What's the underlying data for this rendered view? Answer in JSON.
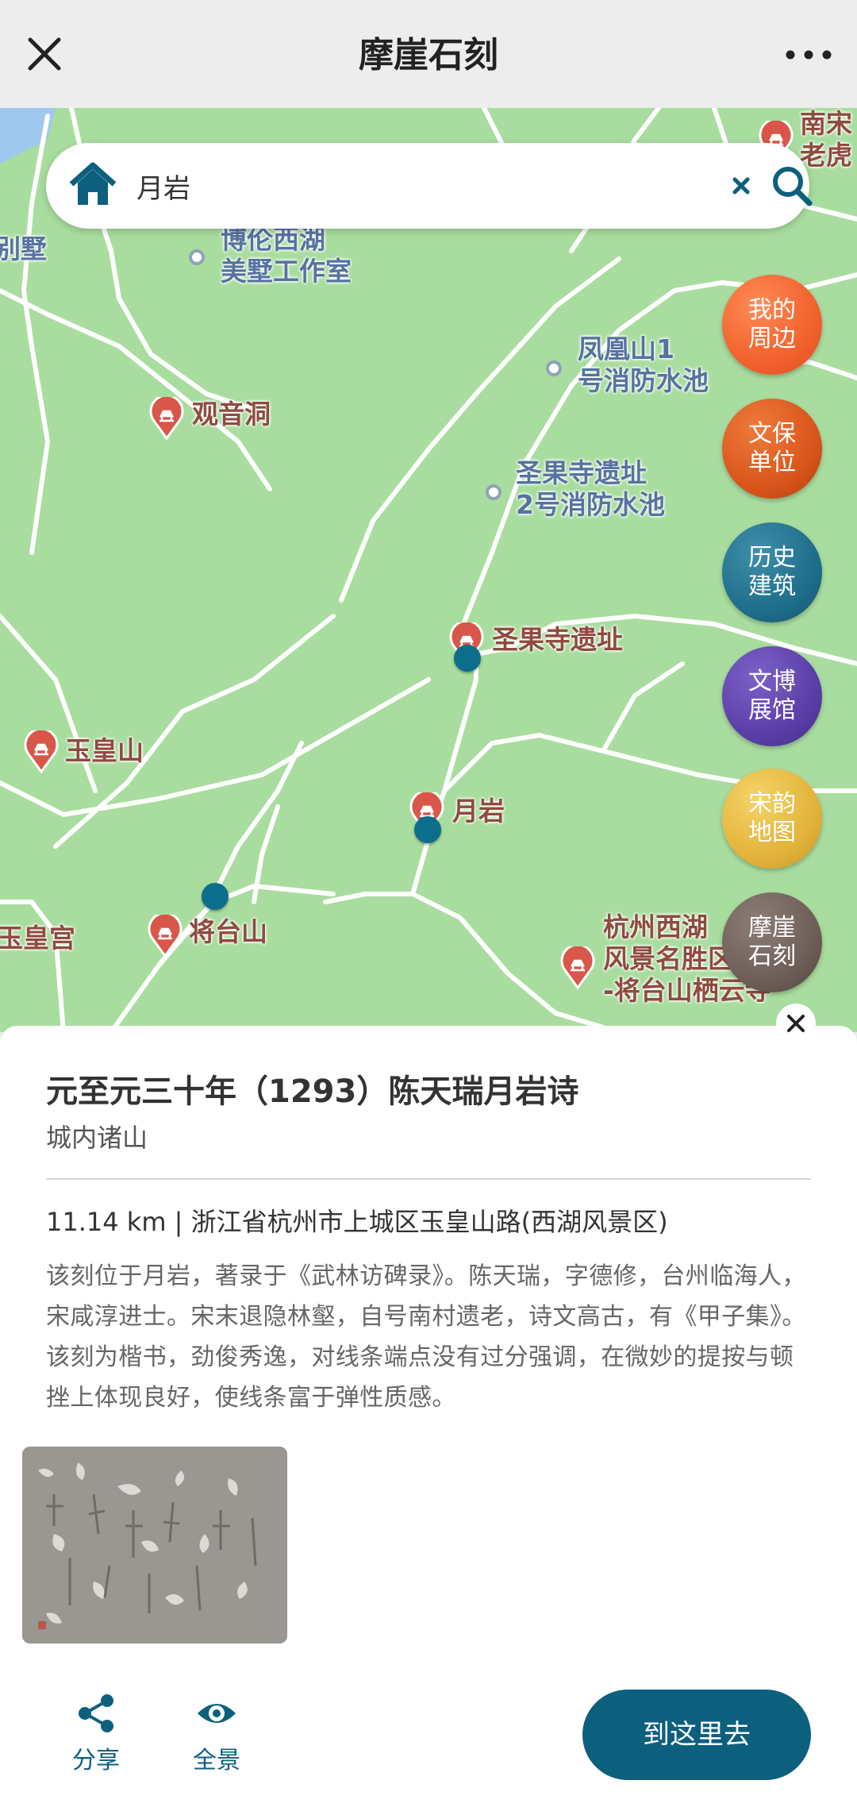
{
  "header": {
    "title": "摩崖石刻"
  },
  "search": {
    "value": "月岩"
  },
  "map": {
    "place_labels": {
      "boluo": "博伦西湖\n美墅工作室",
      "bieshu": "苑别墅",
      "guanyin": "观音洞",
      "fenghuang": "凤凰山1\n号消防水池",
      "shengguo_pool": "圣果寺遗址\n2号消防水池",
      "shengguo": "圣果寺遗址",
      "yuhuangshan": "玉皇山",
      "yueyan": "月岩",
      "jiangtai": "将台山",
      "yuhuanggong": "玉皇宫",
      "xihu": "杭州西湖\n风景名胜区\n-将台山栖云寺",
      "nansong": "南宋\n老虎"
    }
  },
  "categories": [
    {
      "label": "我的周边",
      "color": "#f2622e"
    },
    {
      "label": "文保单位",
      "color": "#d9561c"
    },
    {
      "label": "历史建筑",
      "color": "#1f6f8c"
    },
    {
      "label": "文博展馆",
      "color": "#5b3fa8"
    },
    {
      "label": "宋韵地图",
      "color": "#e3b43a"
    },
    {
      "label": "摩崖石刻",
      "color": "#6f5f58"
    }
  ],
  "detail": {
    "title": "元至元三十年（1293）陈天瑞月岩诗",
    "subtitle": "城内诸山",
    "address": "11.14 km | 浙江省杭州市上城区玉皇山路(西湖风景区)",
    "description": "该刻位于月岩，著录于《武林访碑录》。陈天瑞，字德修，台州临海人，宋咸淳进士。宋末退隐林壑，自号南村遗老，诗文高古，有《甲子集》。该刻为楷书，劲俊秀逸，对线条端点没有过分强调，在微妙的提按与顿挫上体现良好，使线条富于弹性质感。",
    "share_label": "分享",
    "panorama_label": "全景",
    "go_label": "到这里去"
  },
  "colors": {
    "accent": "#0d5f7e",
    "map_green": "#a9dd9f",
    "poi_red": "#d9574a"
  }
}
